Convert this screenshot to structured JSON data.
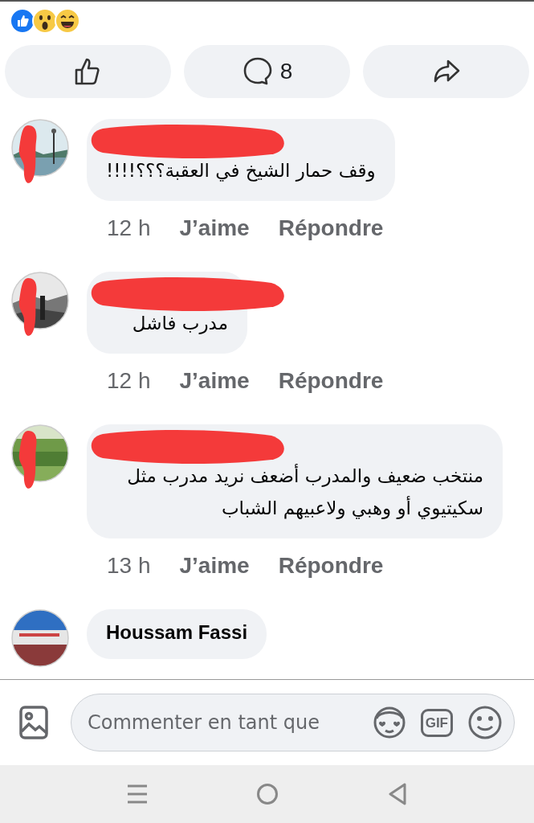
{
  "reactions": [
    {
      "kind": "like"
    },
    {
      "kind": "wow"
    },
    {
      "kind": "haha"
    }
  ],
  "actions": [
    {
      "kind": "like"
    },
    {
      "kind": "comment",
      "count": "8"
    },
    {
      "kind": "share"
    }
  ],
  "comments": [
    {
      "redacted": true,
      "text": "وقف حمار الشيخ في العقبة؟؟؟!!!!",
      "time": "12 h",
      "like": "J’aime",
      "reply": "Répondre"
    },
    {
      "redacted": true,
      "text": "مدرب فاشل",
      "time": "12 h",
      "like": "J’aime",
      "reply": "Répondre"
    },
    {
      "redacted": true,
      "text": "منتخب ضعيف والمدرب أضعف نريد مدرب مثل سكيتيوي أو وهبي ولاعبيهم الشباب",
      "time": "13 h",
      "like": "J’aime",
      "reply": "Répondre"
    },
    {
      "redacted": false,
      "name": "Houssam Fassi"
    }
  ],
  "composer": {
    "placeholder": "Commenter en tant que",
    "gif": "GIF"
  }
}
